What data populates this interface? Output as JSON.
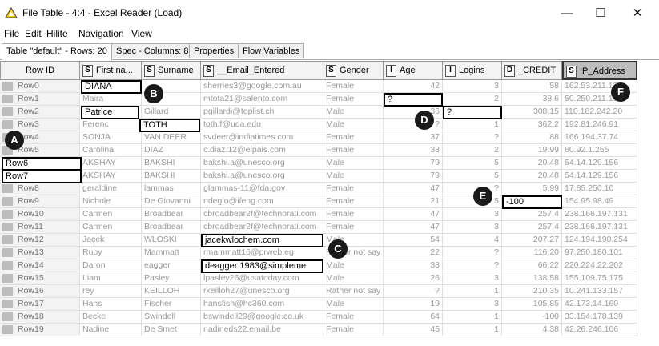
{
  "window": {
    "title": "File Table - 4:4 - Excel Reader (Load)",
    "min": "—",
    "max": "☐",
    "close": "✕"
  },
  "menu": [
    "File",
    "Edit",
    "Hilite",
    "Navigation",
    "View"
  ],
  "tabs": [
    "Table \"default\" - Rows: 20",
    "Spec - Columns: 8",
    "Properties",
    "Flow Variables"
  ],
  "columns": [
    {
      "type": "",
      "label": "Row ID"
    },
    {
      "type": "S",
      "label": "First na..."
    },
    {
      "type": "S",
      "label": "Surname"
    },
    {
      "type": "S",
      "label": "__Email_Entered"
    },
    {
      "type": "S",
      "label": "Gender"
    },
    {
      "type": "I",
      "label": "Age"
    },
    {
      "type": "I",
      "label": "Logins"
    },
    {
      "type": "D",
      "label": "_CREDIT"
    },
    {
      "type": "S",
      "label": "IP_Address"
    }
  ],
  "rows": [
    [
      "Row0",
      "DIANA",
      "",
      "sherries3@google.com.au",
      "Female",
      "42",
      "3",
      "58",
      "162.53.211.13"
    ],
    [
      "Row1",
      "Maira",
      "",
      "mtota21@salento.com",
      "Female",
      "?",
      "2",
      "38.6",
      "50.250.211.196"
    ],
    [
      "Row2",
      "Patrice",
      "Gillard",
      "pgillardi@toplist.ch",
      "Male",
      "36",
      "?",
      "308.15",
      "110.182.242.20"
    ],
    [
      "Row3",
      "Ferenc",
      "TOTH",
      "toth.f@uda.edu",
      "Male",
      "?",
      "1",
      "362.2",
      "192.81.246.91"
    ],
    [
      "Row4",
      "SONJA",
      "VAN DEER",
      "svdeer@indiatimes.com",
      "Female",
      "37",
      "?",
      "88",
      "166.194.37.74"
    ],
    [
      "Row5",
      "Carolina",
      "DIAZ",
      "c.diaz.12@elpais.com",
      "Female",
      "38",
      "2",
      "19.99",
      "60.92.1.255"
    ],
    [
      "Row6",
      "AKSHAY",
      "BAKSHI",
      "bakshi.a@unesco.org",
      "Male",
      "79",
      "5",
      "20.48",
      "54.14.129.156"
    ],
    [
      "Row7",
      "AKSHAY",
      "BAKSHI",
      "bakshi.a@unesco.org",
      "Male",
      "79",
      "5",
      "20.48",
      "54.14.129.156"
    ],
    [
      "Row8",
      "geraldine",
      "lammas",
      "glammas-11@fda.gov",
      "Female",
      "47",
      "?",
      "5.99",
      "17.85.250.10"
    ],
    [
      "Row9",
      "Nichole",
      "De Giovanni",
      "ndegio@ifeng.com",
      "Female",
      "21",
      "5",
      "-100",
      "154.95.98.49"
    ],
    [
      "Row10",
      "Carmen",
      "Broadbear",
      "cbroadbear2f@technorati.com",
      "Female",
      "47",
      "3",
      "257.4",
      "238.166.197.131"
    ],
    [
      "Row11",
      "Carmen",
      "Broadbear",
      "cbroadbear2f@technorati.com",
      "Female",
      "47",
      "3",
      "257.4",
      "238.166.197.131"
    ],
    [
      "Row12",
      "Jacek",
      "WLOSKI",
      "jacekwlochem.com",
      "Male",
      "54",
      "4",
      "207.27",
      "124.194.190.254"
    ],
    [
      "Row13",
      "Ruby",
      "Mammatt",
      "rmammatt16@prweb.eg",
      "Rather not say",
      "22",
      "?",
      "116.20",
      "97.250.180.101"
    ],
    [
      "Row14",
      "Daron",
      "eagger",
      "deagger 1983@simpleme",
      "Male",
      "38",
      "?",
      "66.22",
      "220.224.22.202"
    ],
    [
      "Row15",
      "Liam",
      "Pasley",
      "lpasley26@usatoday.com",
      "Male",
      "26",
      "3",
      "138.58",
      "155.109.75.175"
    ],
    [
      "Row16",
      "rey",
      "KEILLOH",
      "rkeilloh27@unesco.org",
      "Rather not say",
      "?",
      "1",
      "210.35",
      "10.241.133.157"
    ],
    [
      "Row17",
      "Hans",
      "Fischer",
      "hansfish@hc360.com",
      "Male",
      "19",
      "3",
      "105.85",
      "42.173.14.160"
    ],
    [
      "Row18",
      "Becke",
      "Swindell",
      "bswindell29@google.co.uk",
      "Female",
      "64",
      "1",
      "-100",
      "33.154.178.139"
    ],
    [
      "Row19",
      "Nadine",
      "De Smet",
      "nadineds22.email.be",
      "Female",
      "45",
      "1",
      "4.38",
      "42.26.246.106"
    ]
  ],
  "callouts": [
    "A",
    "B",
    "C",
    "D",
    "E",
    "F"
  ]
}
